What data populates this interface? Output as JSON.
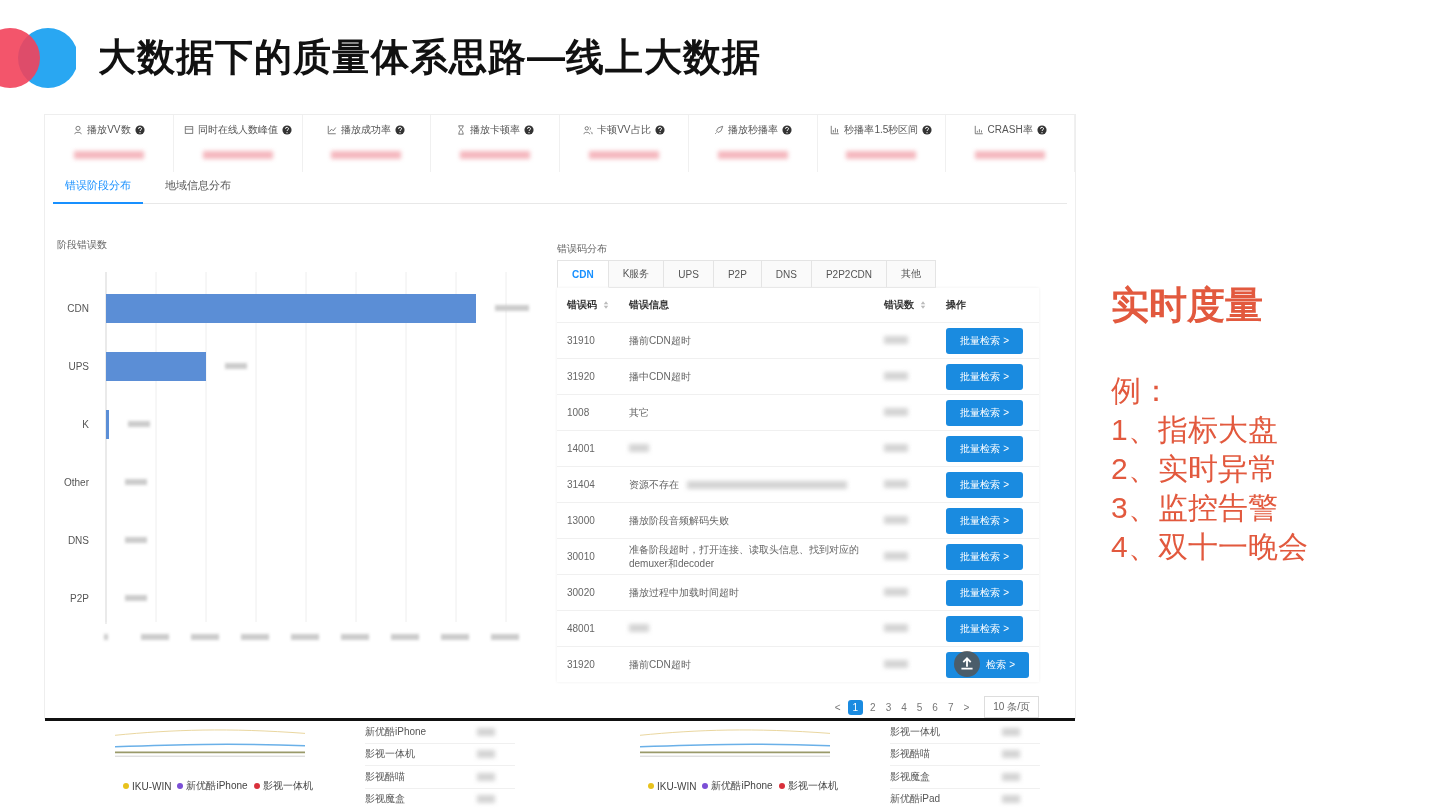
{
  "slide": {
    "title": "大数据下的质量体系思路—线上大数据"
  },
  "metrics": [
    {
      "label": "播放VV数"
    },
    {
      "label": "同时在线人数峰值"
    },
    {
      "label": "播放成功率"
    },
    {
      "label": "播放卡顿率"
    },
    {
      "label": "卡顿VV占比"
    },
    {
      "label": "播放秒播率"
    },
    {
      "label": "秒播率1.5秒区间"
    },
    {
      "label": "CRASH率"
    }
  ],
  "tabs": [
    {
      "label": "错误阶段分布",
      "selected": true
    },
    {
      "label": "地域信息分布",
      "selected": false
    }
  ],
  "stage_chart": {
    "title": "阶段错误数",
    "categories": [
      "CDN",
      "UPS",
      "K",
      "Other",
      "DNS",
      "P2P"
    ]
  },
  "error_panel": {
    "title": "错误码分布",
    "tabs": [
      {
        "label": "CDN",
        "selected": true
      },
      {
        "label": "K服务",
        "selected": false
      },
      {
        "label": "UPS",
        "selected": false
      },
      {
        "label": "P2P",
        "selected": false
      },
      {
        "label": "DNS",
        "selected": false
      },
      {
        "label": "P2P2CDN",
        "selected": false
      },
      {
        "label": "其他",
        "selected": false
      }
    ],
    "columns": [
      {
        "label": "错误码",
        "sortable": true
      },
      {
        "label": "错误信息",
        "sortable": false
      },
      {
        "label": "错误数",
        "sortable": true
      },
      {
        "label": "操作",
        "sortable": false
      }
    ],
    "rows": [
      {
        "code": "31910",
        "message": "播前CDN超时",
        "action": "批量检索 >"
      },
      {
        "code": "31920",
        "message": "播中CDN超时",
        "action": "批量检索 >"
      },
      {
        "code": "1008",
        "message": "其它",
        "action": "批量检索 >"
      },
      {
        "code": "14001",
        "action": "批量检索 >"
      },
      {
        "code": "31404",
        "message": "资源不存在",
        "action": "批量检索 >"
      },
      {
        "code": "13000",
        "message": "播放阶段音频解码失败",
        "action": "批量检索 >"
      },
      {
        "code": "30010",
        "message": "准备阶段超时，打开连接、读取头信息、找到对应的demuxer和decoder",
        "action": "批量检索 >"
      },
      {
        "code": "30020",
        "message": "播放过程中加载时间超时",
        "action": "批量检索 >"
      },
      {
        "code": "48001",
        "action": "批量检索 >"
      },
      {
        "code": "31920",
        "message": "播前CDN超时",
        "action": "检索 >"
      }
    ],
    "pagination": {
      "prev": "<",
      "pages": [
        {
          "label": "1",
          "selected": true
        },
        {
          "label": "2",
          "selected": false
        },
        {
          "label": "3",
          "selected": false
        },
        {
          "label": "4",
          "selected": false
        },
        {
          "label": "5",
          "selected": false
        },
        {
          "label": "6",
          "selected": false
        },
        {
          "label": "7",
          "selected": false
        }
      ],
      "next": ">",
      "page_size": "10 条/页"
    }
  },
  "bottom_panels": [
    {
      "legend": [
        {
          "label": "IKU-WIN",
          "color": "#e8c21c"
        },
        {
          "label": "新优酷iPhone",
          "color": "#7b4fd6"
        },
        {
          "label": "影视一体机",
          "color": "#d9303b"
        }
      ],
      "devices": [
        "新优酷iPhone",
        "影视一体机",
        "影视酷喵",
        "影视魔盒"
      ]
    },
    {
      "legend": [
        {
          "label": "IKU-WIN",
          "color": "#e8c21c"
        },
        {
          "label": "新优酷iPhone",
          "color": "#7b4fd6"
        },
        {
          "label": "影视一体机",
          "color": "#d9303b"
        }
      ],
      "devices": [
        "影视一体机",
        "影视酷喵",
        "影视魔盒",
        "新优酷iPad"
      ]
    }
  ],
  "notes": {
    "heading": "实时度量",
    "intro": "例：",
    "items": [
      "1、指标大盘",
      "2、实时异常",
      "3、监控告警",
      "4、双十一晚会"
    ]
  }
}
